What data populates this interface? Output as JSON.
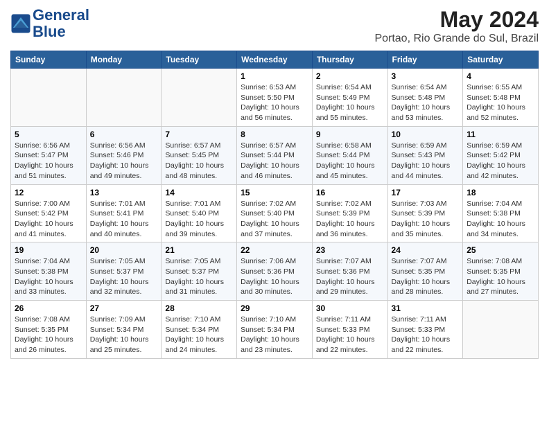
{
  "header": {
    "logo_line1": "General",
    "logo_line2": "Blue",
    "title": "May 2024",
    "subtitle": "Portao, Rio Grande do Sul, Brazil"
  },
  "weekdays": [
    "Sunday",
    "Monday",
    "Tuesday",
    "Wednesday",
    "Thursday",
    "Friday",
    "Saturday"
  ],
  "weeks": [
    [
      {
        "day": "",
        "sunrise": "",
        "sunset": "",
        "daylight": "",
        "empty": true
      },
      {
        "day": "",
        "sunrise": "",
        "sunset": "",
        "daylight": "",
        "empty": true
      },
      {
        "day": "",
        "sunrise": "",
        "sunset": "",
        "daylight": "",
        "empty": true
      },
      {
        "day": "1",
        "sunrise": "Sunrise: 6:53 AM",
        "sunset": "Sunset: 5:50 PM",
        "daylight": "Daylight: 10 hours and 56 minutes."
      },
      {
        "day": "2",
        "sunrise": "Sunrise: 6:54 AM",
        "sunset": "Sunset: 5:49 PM",
        "daylight": "Daylight: 10 hours and 55 minutes."
      },
      {
        "day": "3",
        "sunrise": "Sunrise: 6:54 AM",
        "sunset": "Sunset: 5:48 PM",
        "daylight": "Daylight: 10 hours and 53 minutes."
      },
      {
        "day": "4",
        "sunrise": "Sunrise: 6:55 AM",
        "sunset": "Sunset: 5:48 PM",
        "daylight": "Daylight: 10 hours and 52 minutes."
      }
    ],
    [
      {
        "day": "5",
        "sunrise": "Sunrise: 6:56 AM",
        "sunset": "Sunset: 5:47 PM",
        "daylight": "Daylight: 10 hours and 51 minutes."
      },
      {
        "day": "6",
        "sunrise": "Sunrise: 6:56 AM",
        "sunset": "Sunset: 5:46 PM",
        "daylight": "Daylight: 10 hours and 49 minutes."
      },
      {
        "day": "7",
        "sunrise": "Sunrise: 6:57 AM",
        "sunset": "Sunset: 5:45 PM",
        "daylight": "Daylight: 10 hours and 48 minutes."
      },
      {
        "day": "8",
        "sunrise": "Sunrise: 6:57 AM",
        "sunset": "Sunset: 5:44 PM",
        "daylight": "Daylight: 10 hours and 46 minutes."
      },
      {
        "day": "9",
        "sunrise": "Sunrise: 6:58 AM",
        "sunset": "Sunset: 5:44 PM",
        "daylight": "Daylight: 10 hours and 45 minutes."
      },
      {
        "day": "10",
        "sunrise": "Sunrise: 6:59 AM",
        "sunset": "Sunset: 5:43 PM",
        "daylight": "Daylight: 10 hours and 44 minutes."
      },
      {
        "day": "11",
        "sunrise": "Sunrise: 6:59 AM",
        "sunset": "Sunset: 5:42 PM",
        "daylight": "Daylight: 10 hours and 42 minutes."
      }
    ],
    [
      {
        "day": "12",
        "sunrise": "Sunrise: 7:00 AM",
        "sunset": "Sunset: 5:42 PM",
        "daylight": "Daylight: 10 hours and 41 minutes."
      },
      {
        "day": "13",
        "sunrise": "Sunrise: 7:01 AM",
        "sunset": "Sunset: 5:41 PM",
        "daylight": "Daylight: 10 hours and 40 minutes."
      },
      {
        "day": "14",
        "sunrise": "Sunrise: 7:01 AM",
        "sunset": "Sunset: 5:40 PM",
        "daylight": "Daylight: 10 hours and 39 minutes."
      },
      {
        "day": "15",
        "sunrise": "Sunrise: 7:02 AM",
        "sunset": "Sunset: 5:40 PM",
        "daylight": "Daylight: 10 hours and 37 minutes."
      },
      {
        "day": "16",
        "sunrise": "Sunrise: 7:02 AM",
        "sunset": "Sunset: 5:39 PM",
        "daylight": "Daylight: 10 hours and 36 minutes."
      },
      {
        "day": "17",
        "sunrise": "Sunrise: 7:03 AM",
        "sunset": "Sunset: 5:39 PM",
        "daylight": "Daylight: 10 hours and 35 minutes."
      },
      {
        "day": "18",
        "sunrise": "Sunrise: 7:04 AM",
        "sunset": "Sunset: 5:38 PM",
        "daylight": "Daylight: 10 hours and 34 minutes."
      }
    ],
    [
      {
        "day": "19",
        "sunrise": "Sunrise: 7:04 AM",
        "sunset": "Sunset: 5:38 PM",
        "daylight": "Daylight: 10 hours and 33 minutes."
      },
      {
        "day": "20",
        "sunrise": "Sunrise: 7:05 AM",
        "sunset": "Sunset: 5:37 PM",
        "daylight": "Daylight: 10 hours and 32 minutes."
      },
      {
        "day": "21",
        "sunrise": "Sunrise: 7:05 AM",
        "sunset": "Sunset: 5:37 PM",
        "daylight": "Daylight: 10 hours and 31 minutes."
      },
      {
        "day": "22",
        "sunrise": "Sunrise: 7:06 AM",
        "sunset": "Sunset: 5:36 PM",
        "daylight": "Daylight: 10 hours and 30 minutes."
      },
      {
        "day": "23",
        "sunrise": "Sunrise: 7:07 AM",
        "sunset": "Sunset: 5:36 PM",
        "daylight": "Daylight: 10 hours and 29 minutes."
      },
      {
        "day": "24",
        "sunrise": "Sunrise: 7:07 AM",
        "sunset": "Sunset: 5:35 PM",
        "daylight": "Daylight: 10 hours and 28 minutes."
      },
      {
        "day": "25",
        "sunrise": "Sunrise: 7:08 AM",
        "sunset": "Sunset: 5:35 PM",
        "daylight": "Daylight: 10 hours and 27 minutes."
      }
    ],
    [
      {
        "day": "26",
        "sunrise": "Sunrise: 7:08 AM",
        "sunset": "Sunset: 5:35 PM",
        "daylight": "Daylight: 10 hours and 26 minutes."
      },
      {
        "day": "27",
        "sunrise": "Sunrise: 7:09 AM",
        "sunset": "Sunset: 5:34 PM",
        "daylight": "Daylight: 10 hours and 25 minutes."
      },
      {
        "day": "28",
        "sunrise": "Sunrise: 7:10 AM",
        "sunset": "Sunset: 5:34 PM",
        "daylight": "Daylight: 10 hours and 24 minutes."
      },
      {
        "day": "29",
        "sunrise": "Sunrise: 7:10 AM",
        "sunset": "Sunset: 5:34 PM",
        "daylight": "Daylight: 10 hours and 23 minutes."
      },
      {
        "day": "30",
        "sunrise": "Sunrise: 7:11 AM",
        "sunset": "Sunset: 5:33 PM",
        "daylight": "Daylight: 10 hours and 22 minutes."
      },
      {
        "day": "31",
        "sunrise": "Sunrise: 7:11 AM",
        "sunset": "Sunset: 5:33 PM",
        "daylight": "Daylight: 10 hours and 22 minutes."
      },
      {
        "day": "",
        "sunrise": "",
        "sunset": "",
        "daylight": "",
        "empty": true
      }
    ]
  ]
}
